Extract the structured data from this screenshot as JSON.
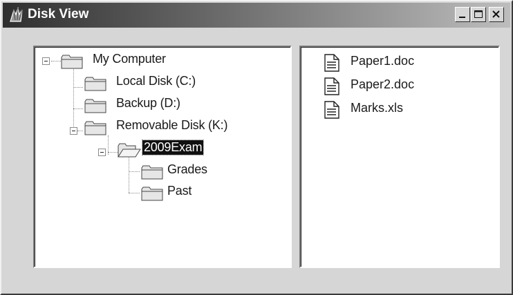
{
  "window": {
    "title": "Disk View",
    "controls": {
      "minimize": "_",
      "maximize": "□",
      "close": "X"
    }
  },
  "tree": {
    "root": {
      "label": "My Computer",
      "icon": "folder-icon",
      "expanded": true
    },
    "items": [
      {
        "label": "Local Disk (C:)",
        "icon": "folder-icon",
        "level": 1
      },
      {
        "label": "Backup (D:)",
        "icon": "folder-icon",
        "level": 1
      },
      {
        "label": "Removable Disk (K:)",
        "icon": "folder-icon",
        "level": 1,
        "expanded": true
      },
      {
        "label": "2009Exam",
        "icon": "open-folder-icon",
        "level": 2,
        "expanded": true,
        "selected": true
      },
      {
        "label": "Grades",
        "icon": "folder-icon",
        "level": 3
      },
      {
        "label": "Past",
        "icon": "folder-icon",
        "level": 3
      }
    ]
  },
  "files": [
    {
      "name": "Paper1.doc",
      "icon": "document-icon"
    },
    {
      "name": "Paper2.doc",
      "icon": "document-icon"
    },
    {
      "name": "Marks.xls",
      "icon": "document-icon"
    }
  ],
  "colors": {
    "titlebar_start": "#2f2f2f",
    "titlebar_end": "#bdbdbd",
    "window_face": "#d6d6d6",
    "selection_bg": "#111111"
  }
}
